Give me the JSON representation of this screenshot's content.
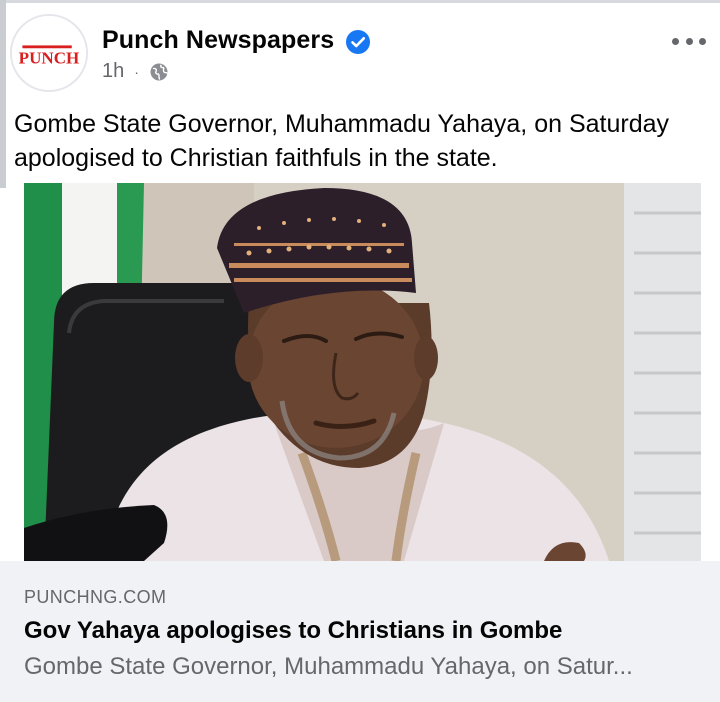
{
  "post": {
    "page_name": "Punch Newspapers",
    "avatar_text": "PUNCH",
    "verified_icon": "verified-badge-icon",
    "time": "1h",
    "separator": "·",
    "audience_icon": "globe-icon",
    "more_icon": "more-options-icon",
    "text_line1": "Gombe State Governor, Muhammadu Yahaya, on Saturday",
    "text_line2": "apologised to Christian faithfuls in the state."
  },
  "link_preview": {
    "domain": "PUNCHNG.COM",
    "headline": "Gov Yahaya apologises to Christians in Gombe",
    "description": "Gombe State Governor, Muhammadu Yahaya, on Satur..."
  },
  "colors": {
    "brand_red": "#d9201f",
    "verified_blue": "#1877f2",
    "card_bg": "#f0f2f5",
    "secondary_text": "#65676b"
  }
}
